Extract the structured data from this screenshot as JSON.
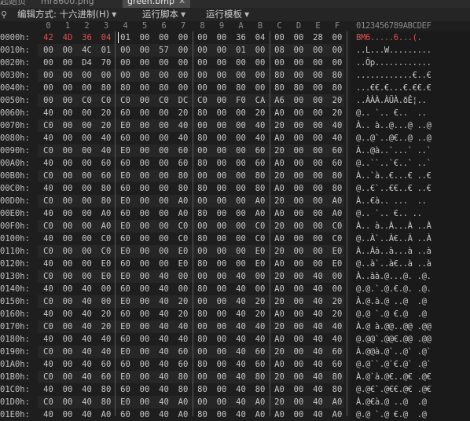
{
  "tabs": [
    {
      "label": "起始页",
      "close": ""
    },
    {
      "label": "mr8600.png",
      "close": ""
    },
    {
      "label": "green.bmp",
      "close": "✕"
    }
  ],
  "menu": {
    "icon": "pin-icon",
    "items": [
      {
        "label": "编辑方式: 十六进制(H)"
      },
      {
        "label": "运行脚本"
      },
      {
        "label": "运行模板"
      }
    ]
  },
  "column_headers": [
    "0",
    "1",
    "2",
    "3",
    "4",
    "5",
    "6",
    "7",
    "8",
    "9",
    "A",
    "B",
    "C",
    "D",
    "E",
    "F"
  ],
  "ascii_header": "0123456789ABCDEF",
  "rows": [
    {
      "offset": "0000h:",
      "bytes": [
        "42",
        "4D",
        "36",
        "04",
        "01",
        "00",
        "00",
        "00",
        "00",
        "00",
        "36",
        "04",
        "00",
        "00",
        "28",
        "00"
      ],
      "ascii": "BM6.....6...(."
    },
    {
      "offset": "0010h:",
      "bytes": [
        "00",
        "00",
        "4C",
        "01",
        "00",
        "00",
        "57",
        "00",
        "00",
        "00",
        "01",
        "00",
        "08",
        "00",
        "00",
        "00"
      ],
      "ascii": "..L...W........."
    },
    {
      "offset": "0020h:",
      "bytes": [
        "00",
        "00",
        "D4",
        "70",
        "00",
        "00",
        "00",
        "00",
        "00",
        "00",
        "00",
        "00",
        "00",
        "00",
        "00",
        "00"
      ],
      "ascii": "..Ôp............"
    },
    {
      "offset": "0030h:",
      "bytes": [
        "00",
        "00",
        "00",
        "00",
        "00",
        "00",
        "00",
        "00",
        "00",
        "00",
        "00",
        "00",
        "80",
        "00",
        "00",
        "80"
      ],
      "ascii": "............€..€"
    },
    {
      "offset": "0040h:",
      "bytes": [
        "00",
        "00",
        "00",
        "80",
        "80",
        "00",
        "80",
        "00",
        "00",
        "00",
        "80",
        "00",
        "80",
        "80",
        "00",
        "80"
      ],
      "ascii": "...€€.€...€.€€.€"
    },
    {
      "offset": "0050h:",
      "bytes": [
        "00",
        "00",
        "C0",
        "C0",
        "C0",
        "00",
        "C0",
        "DC",
        "C0",
        "00",
        "F0",
        "CA",
        "A6",
        "00",
        "00",
        "20"
      ],
      "ascii": "..ÀÀÀ.ÀÜÀ.ðÊ¦.. "
    },
    {
      "offset": "0060h:",
      "bytes": [
        "40",
        "00",
        "00",
        "20",
        "60",
        "00",
        "00",
        "20",
        "80",
        "00",
        "00",
        "20",
        "A0",
        "00",
        "00",
        "20"
      ],
      "ascii": "@.. `.. €..  .. "
    },
    {
      "offset": "0070h:",
      "bytes": [
        "C0",
        "00",
        "00",
        "20",
        "E0",
        "00",
        "00",
        "40",
        "00",
        "00",
        "00",
        "40",
        "20",
        "00",
        "00",
        "40"
      ],
      "ascii": "À.. à..@...@ ..@"
    },
    {
      "offset": "0080h:",
      "bytes": [
        "40",
        "00",
        "00",
        "40",
        "60",
        "00",
        "00",
        "40",
        "80",
        "00",
        "00",
        "40",
        "A0",
        "00",
        "00",
        "40"
      ],
      "ascii": "@..@`..@€..@ ..@"
    },
    {
      "offset": "0090h:",
      "bytes": [
        "C0",
        "00",
        "00",
        "40",
        "E0",
        "00",
        "00",
        "60",
        "00",
        "00",
        "00",
        "60",
        "20",
        "00",
        "00",
        "60"
      ],
      "ascii": "À..@à..`...` ..`"
    },
    {
      "offset": "00A0h:",
      "bytes": [
        "40",
        "00",
        "00",
        "60",
        "60",
        "00",
        "00",
        "60",
        "80",
        "00",
        "00",
        "60",
        "A0",
        "00",
        "00",
        "60"
      ],
      "ascii": "@..``..`€..` ..`"
    },
    {
      "offset": "00B0h:",
      "bytes": [
        "C0",
        "00",
        "00",
        "60",
        "E0",
        "00",
        "00",
        "80",
        "00",
        "00",
        "00",
        "80",
        "20",
        "00",
        "00",
        "80"
      ],
      "ascii": "À..`à..€...€ ..€"
    },
    {
      "offset": "00C0h:",
      "bytes": [
        "40",
        "00",
        "00",
        "80",
        "60",
        "00",
        "00",
        "80",
        "80",
        "00",
        "00",
        "80",
        "A0",
        "00",
        "00",
        "80"
      ],
      "ascii": "@..€`..€€..€ ..€"
    },
    {
      "offset": "00D0h:",
      "bytes": [
        "C0",
        "00",
        "00",
        "80",
        "E0",
        "00",
        "00",
        "A0",
        "00",
        "00",
        "00",
        "A0",
        "20",
        "00",
        "00",
        "A0"
      ],
      "ascii": "À..€à.. ...  .. "
    },
    {
      "offset": "00E0h:",
      "bytes": [
        "40",
        "00",
        "00",
        "A0",
        "60",
        "00",
        "00",
        "A0",
        "80",
        "00",
        "00",
        "A0",
        "A0",
        "00",
        "00",
        "A0"
      ],
      "ascii": "@.. `.. €.. .. "
    },
    {
      "offset": "00F0h:",
      "bytes": [
        "C0",
        "00",
        "00",
        "A0",
        "E0",
        "00",
        "00",
        "C0",
        "00",
        "00",
        "00",
        "C0",
        "20",
        "00",
        "00",
        "C0"
      ],
      "ascii": "À.. à..À...À ..À"
    },
    {
      "offset": "0100h:",
      "bytes": [
        "40",
        "00",
        "00",
        "C0",
        "60",
        "00",
        "00",
        "C0",
        "80",
        "00",
        "00",
        "C0",
        "A0",
        "00",
        "00",
        "C0"
      ],
      "ascii": "@..À`..À€..À ..À"
    },
    {
      "offset": "0110h:",
      "bytes": [
        "C0",
        "00",
        "00",
        "C0",
        "E0",
        "00",
        "00",
        "E0",
        "00",
        "00",
        "00",
        "E0",
        "20",
        "00",
        "00",
        "E0"
      ],
      "ascii": "À..Àà..à...à ..à"
    },
    {
      "offset": "0120h:",
      "bytes": [
        "40",
        "00",
        "00",
        "E0",
        "60",
        "00",
        "00",
        "E0",
        "80",
        "00",
        "00",
        "E0",
        "A0",
        "00",
        "00",
        "E0"
      ],
      "ascii": "@..à`..à€..à ..à"
    },
    {
      "offset": "0130h:",
      "bytes": [
        "C0",
        "00",
        "00",
        "E0",
        "E0",
        "00",
        "40",
        "00",
        "00",
        "00",
        "40",
        "00",
        "20",
        "00",
        "40",
        "00"
      ],
      "ascii": "À..àà.@...@. .@."
    },
    {
      "offset": "0140h:",
      "bytes": [
        "40",
        "00",
        "40",
        "00",
        "60",
        "00",
        "40",
        "00",
        "80",
        "00",
        "40",
        "00",
        "A0",
        "00",
        "40",
        "00"
      ],
      "ascii": "@.@.`.@.€.@. .@."
    },
    {
      "offset": "0150h:",
      "bytes": [
        "C0",
        "00",
        "40",
        "00",
        "E0",
        "00",
        "40",
        "20",
        "00",
        "00",
        "40",
        "20",
        "20",
        "00",
        "40",
        "20"
      ],
      "ascii": "À.@.à.@ ..@  .@ "
    },
    {
      "offset": "0160h:",
      "bytes": [
        "40",
        "00",
        "40",
        "20",
        "60",
        "00",
        "40",
        "20",
        "80",
        "00",
        "40",
        "20",
        "A0",
        "00",
        "40",
        "20"
      ],
      "ascii": "@.@ `.@ €.@  .@ "
    },
    {
      "offset": "0170h:",
      "bytes": [
        "C0",
        "00",
        "40",
        "20",
        "E0",
        "00",
        "40",
        "40",
        "00",
        "00",
        "40",
        "40",
        "20",
        "00",
        "40",
        "40"
      ],
      "ascii": "À.@ à.@@..@@ .@@"
    },
    {
      "offset": "0180h:",
      "bytes": [
        "40",
        "00",
        "40",
        "40",
        "60",
        "00",
        "40",
        "40",
        "80",
        "00",
        "40",
        "40",
        "A0",
        "00",
        "40",
        "40"
      ],
      "ascii": "@.@@`.@@€.@@ .@@"
    },
    {
      "offset": "0190h:",
      "bytes": [
        "C0",
        "00",
        "40",
        "40",
        "E0",
        "00",
        "40",
        "60",
        "00",
        "00",
        "40",
        "60",
        "20",
        "00",
        "40",
        "60"
      ],
      "ascii": "À.@@à.@`..@` .@`"
    },
    {
      "offset": "01A0h:",
      "bytes": [
        "40",
        "00",
        "40",
        "60",
        "60",
        "00",
        "40",
        "60",
        "80",
        "00",
        "40",
        "60",
        "A0",
        "00",
        "40",
        "60"
      ],
      "ascii": "@.@``.@`€.@` .@`"
    },
    {
      "offset": "01B0h:",
      "bytes": [
        "C0",
        "00",
        "40",
        "60",
        "E0",
        "00",
        "40",
        "80",
        "00",
        "00",
        "40",
        "80",
        "20",
        "00",
        "40",
        "80"
      ],
      "ascii": "À.@`à.@€..@€ .@€"
    },
    {
      "offset": "01C0h:",
      "bytes": [
        "40",
        "00",
        "40",
        "80",
        "60",
        "00",
        "40",
        "80",
        "80",
        "00",
        "40",
        "80",
        "A0",
        "00",
        "40",
        "80"
      ],
      "ascii": "@.@€`.@€€.@€ .@€"
    },
    {
      "offset": "01D0h:",
      "bytes": [
        "C0",
        "00",
        "40",
        "80",
        "E0",
        "00",
        "40",
        "A0",
        "00",
        "00",
        "40",
        "A0",
        "20",
        "00",
        "40",
        "A0"
      ],
      "ascii": "À.@€à.@ ..@  .@ "
    },
    {
      "offset": "01E0h:",
      "bytes": [
        "40",
        "00",
        "40",
        "A0",
        "60",
        "00",
        "40",
        "A0",
        "80",
        "00",
        "40",
        "A0",
        "A0",
        "00",
        "40",
        "A0"
      ],
      "ascii": "@.@ `.@ €.@  .@ "
    }
  ],
  "selection": {
    "row": 0,
    "start": 0,
    "length": 4
  },
  "colors": {
    "selected_text": "#e05050",
    "selection_bg": "#2e3b4d",
    "background": "#1e1e1e"
  }
}
